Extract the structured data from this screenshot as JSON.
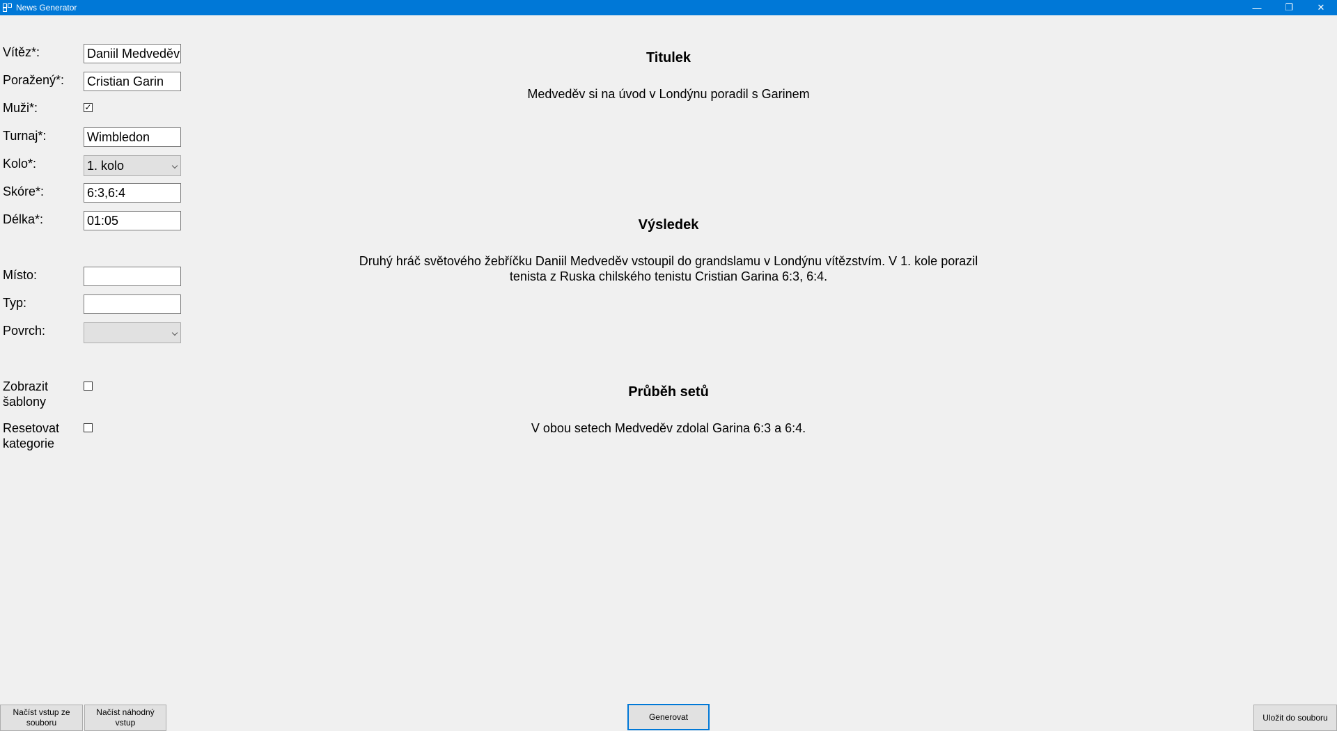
{
  "window": {
    "title": "News Generator",
    "minimize_glyph": "—",
    "restore_glyph": "❐",
    "close_glyph": "✕"
  },
  "form": {
    "vitez": {
      "label": "Vítěz*:",
      "value": "Daniil Medveděv"
    },
    "porazeny": {
      "label": "Poražený*:",
      "value": "Cristian Garin"
    },
    "muzi": {
      "label": "Muži*:",
      "checked": true,
      "check_glyph": "✓"
    },
    "turnaj": {
      "label": "Turnaj*:",
      "value": "Wimbledon"
    },
    "kolo": {
      "label": "Kolo*:",
      "value": "1. kolo"
    },
    "skore": {
      "label": "Skóre*:",
      "value": "6:3,6:4"
    },
    "delka": {
      "label": "Délka*:",
      "value": "01:05"
    },
    "misto": {
      "label": "Místo:",
      "value": ""
    },
    "typ": {
      "label": "Typ:",
      "value": ""
    },
    "povrch": {
      "label": "Povrch:",
      "value": ""
    },
    "zobrazit_sablony": {
      "label_line1": "Zobrazit",
      "label_line2": "šablony",
      "checked": false
    },
    "resetovat_kategorie": {
      "label_line1": "Resetovat",
      "label_line2": "kategorie",
      "checked": false
    }
  },
  "output": {
    "titulek": {
      "heading": "Titulek",
      "text": "Medveděv si na úvod v Londýnu poradil s Garinem"
    },
    "vysledek": {
      "heading": "Výsledek",
      "line1": "Druhý hráč světového žebříčku Daniil Medveděv vstoupil do grandslamu v Londýnu vítězstvím. V 1. kole porazil",
      "line2": "tenista z Ruska chilského tenistu Cristian Garina 6:3, 6:4."
    },
    "prubeh": {
      "heading": "Průběh setů",
      "text": "V obou setech Medveděv zdolal Garina 6:3 a 6:4."
    }
  },
  "buttons": {
    "nacist_soubor_line1": "Načíst vstup ze",
    "nacist_soubor_line2": "souboru",
    "nacist_nahodny_line1": "Načíst náhodný",
    "nacist_nahodny_line2": "vstup",
    "generovat": "Generovat",
    "ulozit": "Uložit do souboru"
  }
}
